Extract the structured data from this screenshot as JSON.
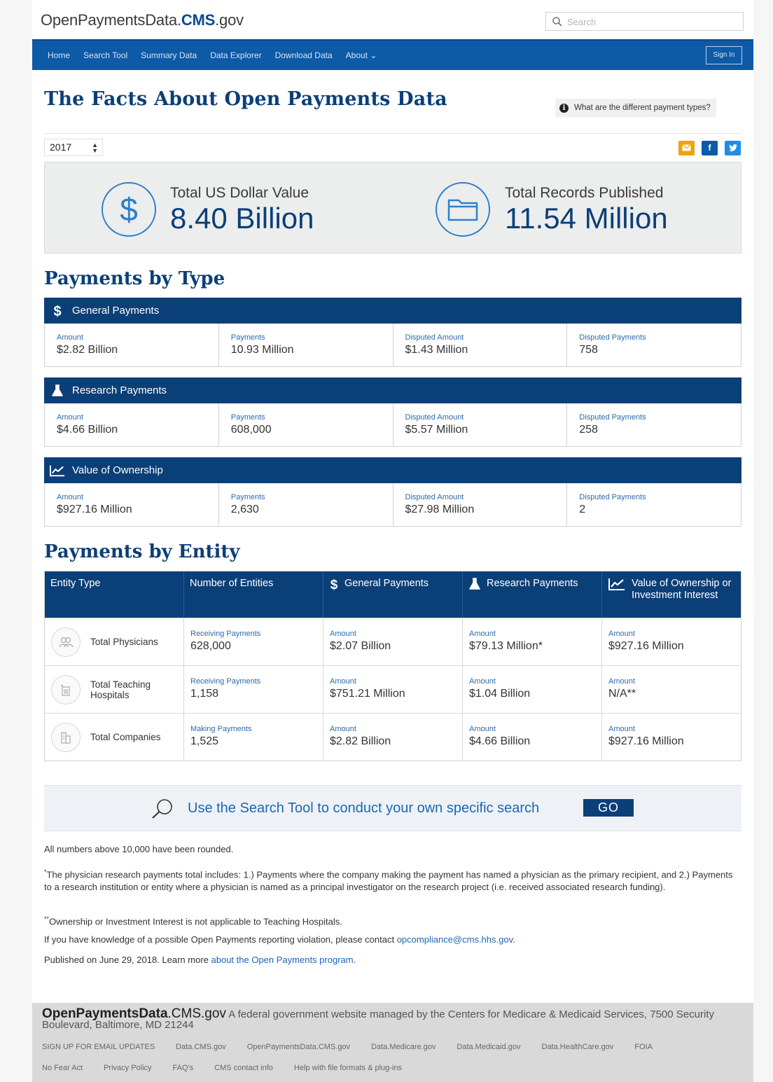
{
  "header": {
    "brand_prefix": "OpenPaymentsData.",
    "brand_bold": "CMS",
    "brand_suffix": ".gov",
    "search_placeholder": "Search",
    "search_icon": "search-icon"
  },
  "nav": {
    "items": [
      "Home",
      "Search Tool",
      "Summary Data",
      "Data Explorer",
      "Download Data",
      "About ⌄"
    ],
    "signin_label": "Sign In"
  },
  "page": {
    "title": "The Facts About Open Payments Data",
    "payment_types_link": "What are the different payment types?",
    "year": "2017"
  },
  "colors": {
    "primary_blue": "#0b3f78",
    "nav_blue": "#0d5aa7",
    "link_blue": "#1d66b3",
    "email_orange": "#f0a30a",
    "facebook_blue": "#0d5aa7",
    "twitter_blue": "#1d8ee8"
  },
  "totals": {
    "dollar": {
      "label": "Total US Dollar Value",
      "value": "8.40 Billion",
      "icon": "dollar-icon"
    },
    "records": {
      "label": "Total Records Published",
      "value": "11.54 Million",
      "icon": "folder-icon"
    }
  },
  "payments_by_type": {
    "heading": "Payments by Type",
    "cards": [
      {
        "title": "General Payments",
        "icon": "dollar-icon",
        "cells": [
          {
            "label": "Amount",
            "value": "$2.82 Billion"
          },
          {
            "label": "Payments",
            "value": "10.93 Million"
          },
          {
            "label": "Disputed Amount",
            "value": "$1.43 Million"
          },
          {
            "label": "Disputed Payments",
            "value": "758"
          }
        ]
      },
      {
        "title": "Research Payments",
        "icon": "flask-icon",
        "cells": [
          {
            "label": "Amount",
            "value": "$4.66 Billion"
          },
          {
            "label": "Payments",
            "value": "608,000"
          },
          {
            "label": "Disputed Amount",
            "value": "$5.57 Million"
          },
          {
            "label": "Disputed Payments",
            "value": "258"
          }
        ]
      },
      {
        "title": "Value of Ownership",
        "icon": "line-chart-icon",
        "cells": [
          {
            "label": "Amount",
            "value": "$927.16 Million"
          },
          {
            "label": "Payments",
            "value": "2,630"
          },
          {
            "label": "Disputed Amount",
            "value": "$27.98 Million"
          },
          {
            "label": "Disputed Payments",
            "value": "2"
          }
        ]
      }
    ]
  },
  "payments_by_entity": {
    "heading": "Payments by Entity",
    "columns": [
      "Entity Type",
      "Number of Entities",
      "General Payments",
      "Research Payments",
      "Value of Ownership or Investment Interest"
    ],
    "rows": [
      {
        "name": "Total Physicians",
        "icon": "physicians-icon",
        "count_label": "Receiving Payments",
        "count": "628,000",
        "general_label": "Amount",
        "general": "$2.07 Billion",
        "research_label": "Amount",
        "research": "$79.13 Million*",
        "ownership_label": "Amount",
        "ownership": "$927.16 Million"
      },
      {
        "name": "Total Teaching Hospitals",
        "icon": "hospital-icon",
        "count_label": "Receiving Payments",
        "count": "1,158",
        "general_label": "Amount",
        "general": "$751.21 Million",
        "research_label": "Amount",
        "research": "$1.04 Billion",
        "ownership_label": "Amount",
        "ownership": "N/A**"
      },
      {
        "name": "Total Companies",
        "icon": "company-icon",
        "count_label": "Making Payments",
        "count": "1,525",
        "general_label": "Amount",
        "general": "$2.82 Billion",
        "research_label": "Amount",
        "research": "$4.66 Billion",
        "ownership_label": "Amount",
        "ownership": "$927.16 Million"
      }
    ]
  },
  "cta": {
    "text": "Use the Search Tool to conduct your own specific search",
    "button": "GO"
  },
  "notes": {
    "rounded": "All numbers above 10,000 have been rounded.",
    "asterisk_mark": "*",
    "asterisk": "The physician research payments total includes: 1.) Payments where the company making the payment has named a physician as the primary recipient, and 2.) Payments to a research institution or entity where a physician is named as a principal investigator on the research project (i.e. received associated research funding).",
    "double_asterisk_mark": "**",
    "double_asterisk": "Ownership or Investment Interest is not applicable to Teaching Hospitals.",
    "violation_prefix": "If you have knowledge of a possible Open Payments reporting violation, please contact ",
    "violation_email": "opcompliance@cms.hhs.gov",
    "violation_suffix": ".",
    "published_prefix": "Published on June 29, 2018. Learn more ",
    "published_link": "about the Open Payments program",
    "published_suffix": "."
  },
  "footer": {
    "brand_bold": "OpenPaymentsData",
    "brand_rest": ".CMS.gov",
    "tagline": "A federal government website managed by the Centers for Medicare & Medicaid Services, 7500 Security Boulevard, Baltimore, MD 21244",
    "links_row1": [
      "SIGN UP FOR EMAIL UPDATES",
      "Data.CMS.gov",
      "OpenPaymentsData.CMS.gov",
      "Data.Medicare.gov",
      "Data.Medicaid.gov",
      "Data.HealthCare.gov",
      "FOIA"
    ],
    "links_row2": [
      "No Fear Act",
      "Privacy Policy",
      "FAQ's",
      "CMS contact info",
      "Help with file formats & plug-ins"
    ]
  }
}
